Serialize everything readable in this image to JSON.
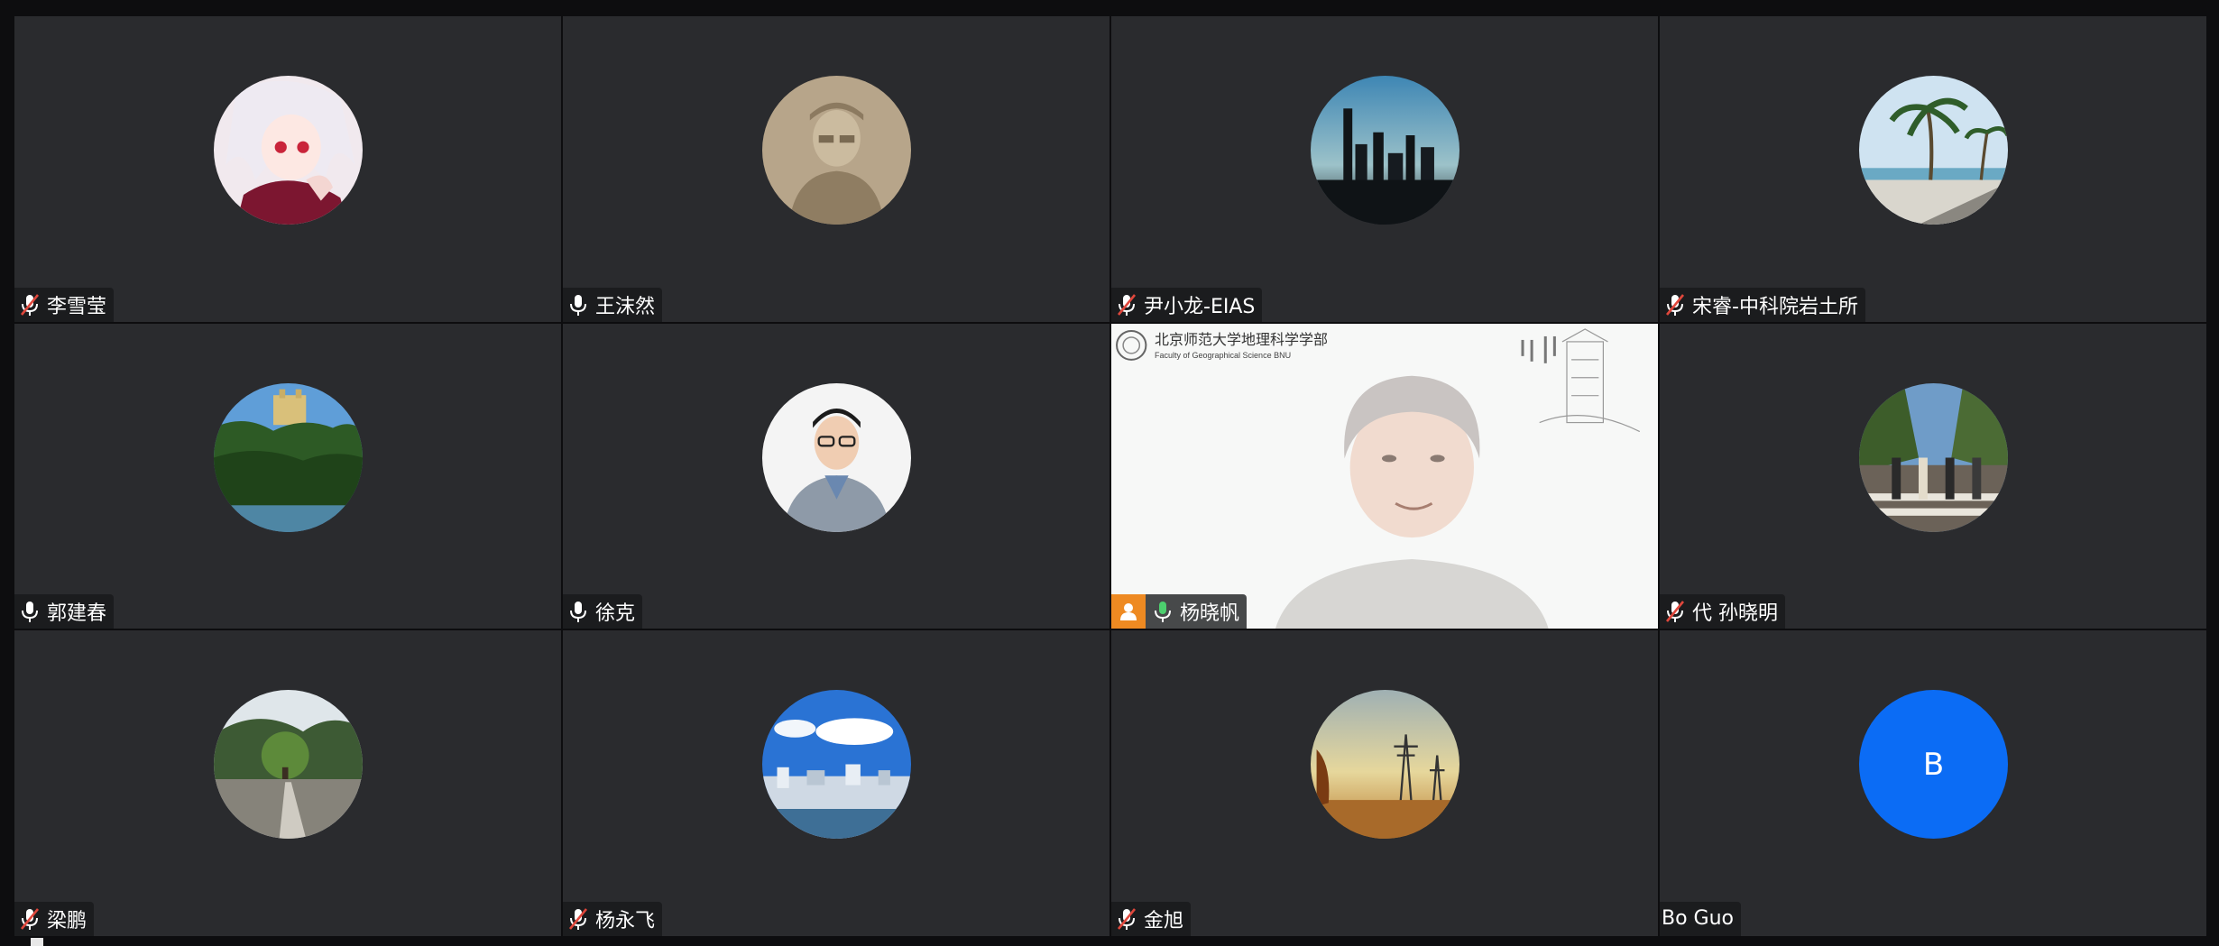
{
  "participants": [
    {
      "name": "李雪莹",
      "mic": "muted",
      "avatar": "anime"
    },
    {
      "name": "王沫然",
      "mic": "on",
      "avatar": "sketch"
    },
    {
      "name": "尹小龙-EIAS",
      "mic": "muted",
      "avatar": "city"
    },
    {
      "name": "宋睿-中科院岩土所",
      "mic": "muted",
      "avatar": "palms"
    },
    {
      "name": "郭建春",
      "mic": "on",
      "avatar": "castle"
    },
    {
      "name": "徐克",
      "mic": "on",
      "avatar": "portrait"
    },
    {
      "name": "杨晓帆",
      "mic": "on",
      "avatar": "video",
      "host": true
    },
    {
      "name": "代 孙晓明",
      "mic": "muted",
      "avatar": "crossing"
    },
    {
      "name": "梁鹏",
      "mic": "muted",
      "avatar": "tree"
    },
    {
      "name": "杨永飞",
      "mic": "muted",
      "avatar": "sky"
    },
    {
      "name": "金旭",
      "mic": "muted",
      "avatar": "pylons"
    },
    {
      "name": "Bo Guo",
      "mic": "none",
      "avatar": "letter",
      "initial": "B"
    }
  ],
  "video_background": {
    "faculty_cn": "北京师范大学地理科学学部",
    "faculty_en": "Faculty of Geographical Science   BNU"
  },
  "colors": {
    "tile_bg": "#2a2b2e",
    "letter_avatar": "#0b6cf5",
    "host_badge": "#ee8a22",
    "active_speaker_border": "#2e8a60",
    "muted_slash": "#e0473c"
  },
  "icons": {
    "mic_on": "microphone-icon",
    "mic_muted": "microphone-muted-icon",
    "host": "host-person-icon"
  }
}
